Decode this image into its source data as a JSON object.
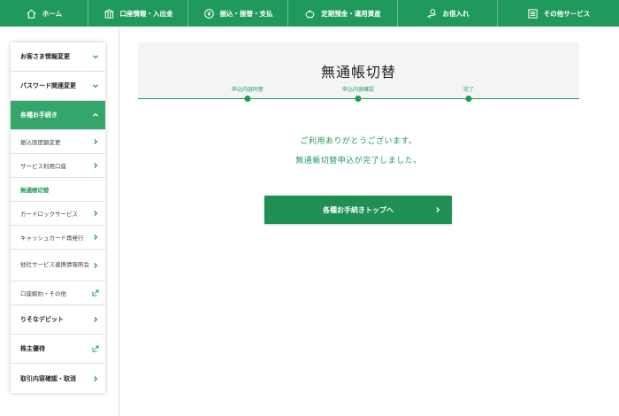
{
  "nav": {
    "items": [
      {
        "label": "ホーム",
        "icon": "home-icon"
      },
      {
        "label": "口座情報・入出金",
        "icon": "bank-icon"
      },
      {
        "label": "振込・振替・支払",
        "icon": "yen-coin-icon"
      },
      {
        "label": "定期預金・運用資産",
        "icon": "piggy-bank-icon"
      },
      {
        "label": "お借入れ",
        "icon": "hand-coin-icon"
      },
      {
        "label": "その他サービス",
        "icon": "list-icon"
      }
    ]
  },
  "sidebar": {
    "items": [
      {
        "label": "お客さま情報変更",
        "icon": "chevron-down-icon"
      },
      {
        "label": "パスワード関連変更",
        "icon": "chevron-down-icon"
      },
      {
        "label": "各種お手続き",
        "icon": "chevron-up-icon"
      },
      {
        "label": "振込限度額変更",
        "icon": "chevron-right-icon"
      },
      {
        "label": "サービス利用口座",
        "icon": "chevron-right-icon"
      },
      {
        "label": "無通帳切替"
      },
      {
        "label": "カードロックサービス",
        "icon": "chevron-right-icon"
      },
      {
        "label": "キャッシュカード再発行",
        "icon": "chevron-right-icon"
      },
      {
        "label": "他社サービス連携情報照会",
        "icon": "chevron-right-icon"
      },
      {
        "label": "口座解約・その他",
        "icon": "external-link-icon"
      },
      {
        "label": "りそなデビット",
        "icon": "chevron-right-icon"
      },
      {
        "label": "株主優待",
        "icon": "external-link-icon"
      },
      {
        "label": "取引内容確認・取消",
        "icon": "chevron-right-icon"
      }
    ]
  },
  "main": {
    "title": "無通帳切替",
    "steps": [
      "申込内容同意",
      "申込内容確認",
      "完了"
    ],
    "message_line1": "ご利用ありがとうございます。",
    "message_line2": "無通帳切替申込が完了しました。",
    "cta_label": "各種お手続きトップへ"
  },
  "colors": {
    "brand": "#1f9a5c",
    "sidebar_active": "#34a66b",
    "title_bg": "#f4f4f4"
  }
}
